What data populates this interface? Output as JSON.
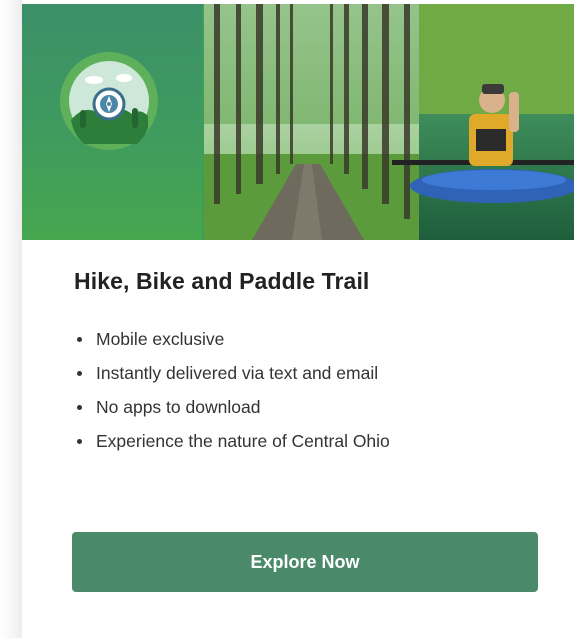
{
  "card": {
    "title": "Hike, Bike and Paddle Trail",
    "features": [
      "Mobile exclusive",
      "Instantly delivered via text and email",
      "No apps to download",
      "Experience the nature of Central Ohio"
    ],
    "cta_label": "Explore Now"
  },
  "banner": {
    "badge_icon": "compass-icon",
    "photo_subject": "trail-and-kayaker-photo"
  },
  "colors": {
    "banner_green": "#3f9d56",
    "badge_green": "#5eb15a",
    "button_green": "#4a8a6b",
    "title_text": "#222222",
    "body_text": "#333333"
  }
}
